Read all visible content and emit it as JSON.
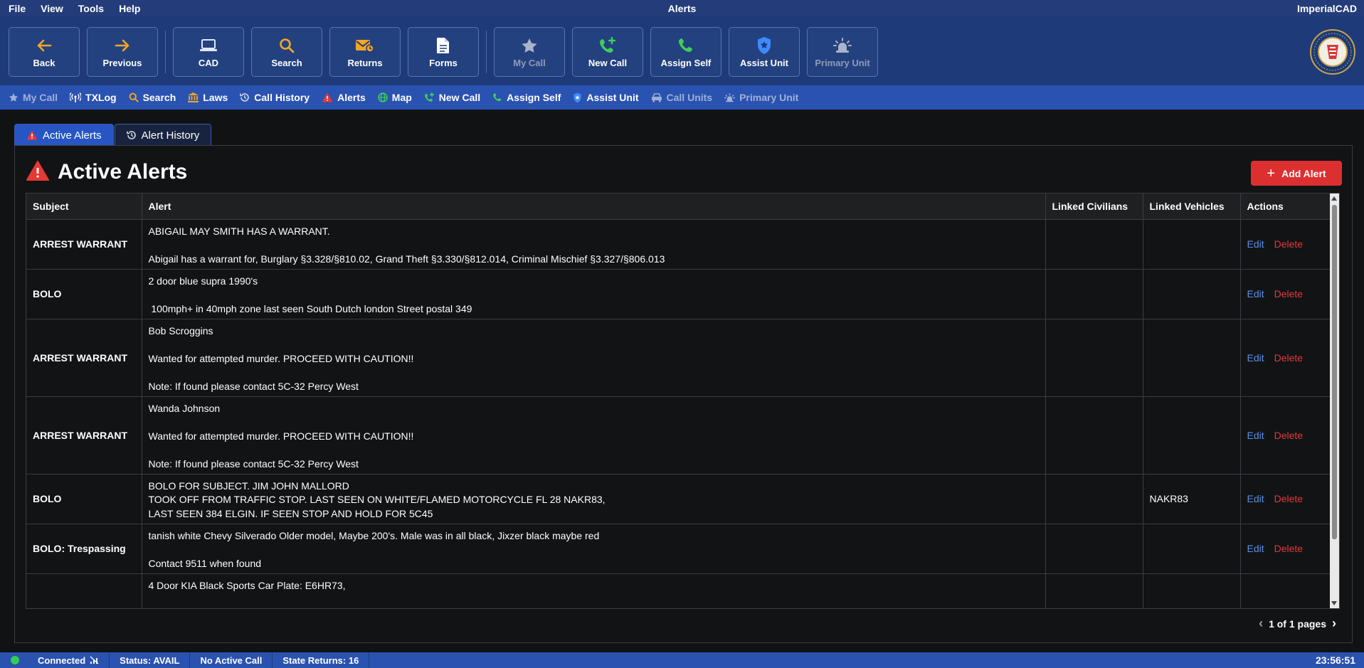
{
  "menubar": {
    "items": [
      "File",
      "View",
      "Tools",
      "Help"
    ],
    "title": "Alerts",
    "brand": "ImperialCAD"
  },
  "toolbar": {
    "back": "Back",
    "previous": "Previous",
    "cad": "CAD",
    "search": "Search",
    "returns": "Returns",
    "forms": "Forms",
    "my_call": "My Call",
    "new_call": "New Call",
    "assign_self": "Assign Self",
    "assist_unit": "Assist Unit",
    "primary_unit": "Primary Unit",
    "seal_text_top": "FLORIDA",
    "seal_text_bottom": "HIGHWAY PATROL"
  },
  "quickbar": {
    "my_call": "My Call",
    "txlog": "TXLog",
    "search": "Search",
    "laws": "Laws",
    "call_history": "Call History",
    "alerts": "Alerts",
    "map": "Map",
    "new_call": "New Call",
    "assign_self": "Assign Self",
    "assist_unit": "Assist Unit",
    "call_units": "Call Units",
    "primary_unit": "Primary Unit"
  },
  "tabs": {
    "active_alerts": "Active Alerts",
    "alert_history": "Alert History"
  },
  "panel": {
    "title": "Active Alerts",
    "add_button": "Add Alert"
  },
  "table": {
    "headers": {
      "subject": "Subject",
      "alert": "Alert",
      "linked_civilians": "Linked Civilians",
      "linked_vehicles": "Linked Vehicles",
      "actions": "Actions"
    },
    "edit_label": "Edit",
    "delete_label": "Delete",
    "rows": [
      {
        "subject": "ARREST WARRANT",
        "alert": "ABIGAIL MAY SMITH HAS A WARRANT.\n\nAbigail has a warrant for, Burglary §3.328/§810.02, Grand Theft §3.330/§812.014, Criminal Mischief §3.327/§806.013",
        "civilians": "",
        "vehicles": ""
      },
      {
        "subject": "BOLO",
        "alert": "2 door blue supra 1990's\n\n 100mph+ in 40mph zone last seen South Dutch london Street postal 349",
        "civilians": "",
        "vehicles": ""
      },
      {
        "subject": "ARREST WARRANT",
        "alert": "Bob Scroggins\n\nWanted for attempted murder. PROCEED WITH CAUTION!!\n\nNote: If found please contact 5C-32 Percy West",
        "civilians": "",
        "vehicles": ""
      },
      {
        "subject": "ARREST WARRANT",
        "alert": "Wanda Johnson\n\nWanted for attempted murder. PROCEED WITH CAUTION!!\n\nNote: If found please contact 5C-32 Percy West",
        "civilians": "",
        "vehicles": ""
      },
      {
        "subject": "BOLO",
        "alert": "BOLO FOR SUBJECT. JIM JOHN MALLORD\nTOOK OFF FROM TRAFFIC STOP. LAST SEEN ON WHITE/FLAMED MOTORCYCLE FL 28 NAKR83,\nLAST SEEN 384 ELGIN. IF SEEN STOP AND HOLD FOR 5C45",
        "civilians": "",
        "vehicles": "NAKR83"
      },
      {
        "subject": "BOLO: Trespassing",
        "alert": "tanish white Chevy Silverado Older model, Maybe 200's. Male was in all black, Jixzer black maybe red\n\nContact 9511 when found",
        "civilians": "",
        "vehicles": ""
      },
      {
        "subject": "",
        "alert": "4 Door KIA Black Sports Car Plate: E6HR73,",
        "civilians": "",
        "vehicles": ""
      }
    ]
  },
  "pager": {
    "text": "1 of 1 pages"
  },
  "statusbar": {
    "connection": "Connected",
    "status": "Status: AVAIL",
    "call": "No Active Call",
    "state_returns": "State Returns: 16",
    "time": "23:56:51"
  },
  "colors": {
    "menubar": "#243d7a",
    "toolbar": "#1f3a78",
    "quickbar": "#2a52b0",
    "danger": "#dc3030",
    "link": "#5a8fe8"
  }
}
